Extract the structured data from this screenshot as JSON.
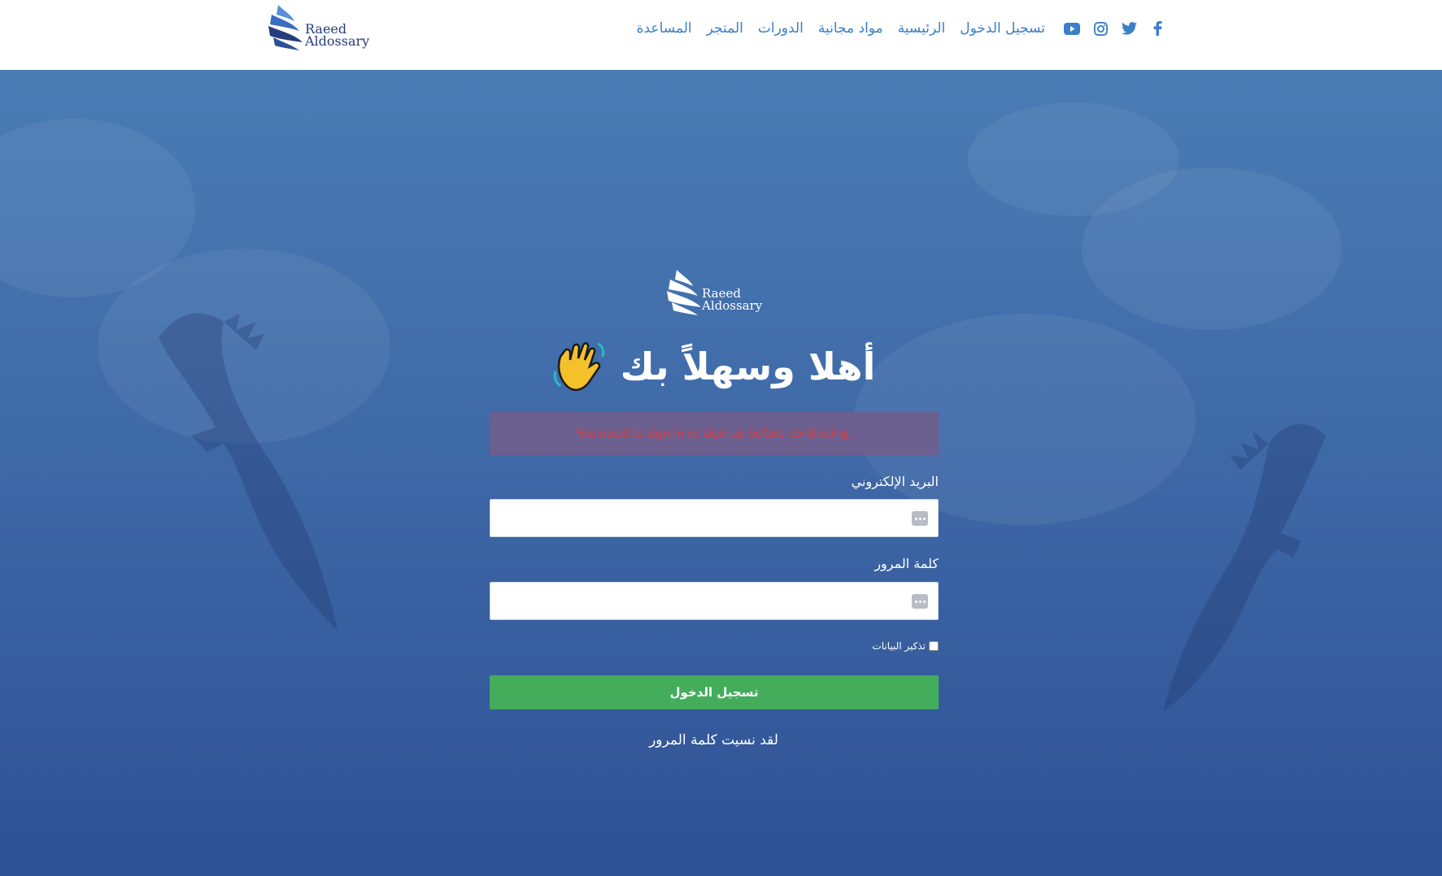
{
  "header": {
    "logo_line1": "Raeed",
    "logo_line2": "Aldossary",
    "social": [
      {
        "name": "facebook-icon"
      },
      {
        "name": "twitter-icon"
      },
      {
        "name": "instagram-icon"
      },
      {
        "name": "youtube-icon"
      }
    ],
    "nav": [
      {
        "label": "تسجيل الدخول"
      },
      {
        "label": "الرئيسية"
      },
      {
        "label": "مواد مجانية"
      },
      {
        "label": "الدورات"
      },
      {
        "label": "المتجر"
      },
      {
        "label": "المساعدة"
      }
    ],
    "link_color": "#3b7fc9"
  },
  "login": {
    "logo_line1": "Raeed",
    "logo_line2": "Aldossary",
    "title": "أهلا وسهلاً بك",
    "wave_icon": "waving-hand-icon",
    "alert": "You need to sign in or sign up before continuing.",
    "email_label": "البريد الإلكتروني",
    "email_value": "",
    "password_label": "كلمة المرور",
    "password_value": "",
    "remember_label": "تذكير البيانات",
    "remember_checked": false,
    "submit_label": "تسجيل الدخول",
    "forgot_label": "لقد نسيت كلمة المرور",
    "submit_color": "#43ad5c",
    "alert_color": "#e23a3a"
  }
}
